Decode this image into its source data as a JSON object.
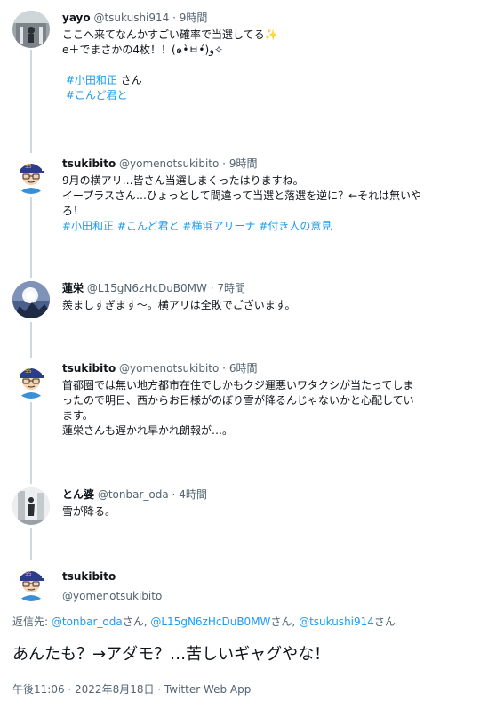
{
  "tweets": [
    {
      "name": "yayo",
      "handle": "@tsukushi914",
      "time": "9時間",
      "lines": [
        "ここへ来てなんかすごい確率で当選してる✨",
        "e＋でまさかの4枚！！(๑•̀ㅂ•́)و✧"
      ],
      "tag_line_1": "#小田和正",
      "tag_line_1_suffix": " さん",
      "tag_line_2": "#こんど君と"
    },
    {
      "name": "tsukibito",
      "handle": "@yomenotsukibito",
      "time": "9時間",
      "lines": [
        "9月の横アリ…皆さん当選しまくったはりますね。",
        "イープラスさん…ひょっとして間違って当選と落選を逆に？←それは無いや",
        "ろ！"
      ],
      "tags": [
        "#小田和正",
        "#こんど君と",
        "#横浜アリーナ",
        "#付き人の意見"
      ]
    },
    {
      "name": "蓮栄",
      "handle": "@L15gN6zHcDuB0MW",
      "time": "7時間",
      "lines": [
        "羨ましすぎます〜。横アリは全敗でございます。"
      ]
    },
    {
      "name": "tsukibito",
      "handle": "@yomenotsukibito",
      "time": "6時間",
      "lines": [
        "首都圏では無い地方都市在住でしかもクジ運悪いワタクシが当たってしま",
        "ったので明日、西からお日様がのぼり雪が降るんじゃないかと心配してい",
        "ます。",
        "蓮栄さんも遅かれ早かれ朗報が…。"
      ]
    },
    {
      "name": "とん婆",
      "handle": "@tonbar_oda",
      "time": "4時間",
      "lines": [
        "雪が降る。"
      ]
    }
  ],
  "dot": "·",
  "main": {
    "name": "tsukibito",
    "handle": "@yomenotsukibito",
    "reply_prefix": "返信先: ",
    "reply_users": [
      "@tonbar_oda",
      "@L15gN6zHcDuB0MW",
      "@tsukushi914"
    ],
    "reply_joiner": "さん, ",
    "reply_suffix": "さん",
    "text": "あんたも？→アダモ？…苦しいギャグやな！",
    "meta": "午後11:06 · 2022年8月18日 · Twitter Web App"
  },
  "colors": {
    "link": "#1d9bf0",
    "secondary_text": "#536471",
    "thread_line": "#cfd9de"
  },
  "icons": [
    "avatar-photo-yayo",
    "avatar-cartoon-tsukibito",
    "avatar-photo-hasuei",
    "avatar-photo-tonbaa"
  ]
}
